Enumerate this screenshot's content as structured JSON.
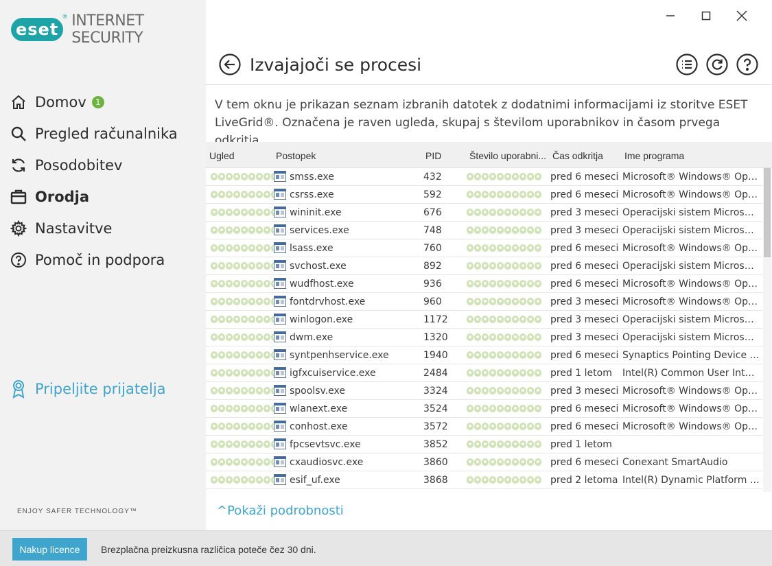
{
  "app": {
    "brand": "eset",
    "product": "INTERNET SECURITY",
    "tagline": "ENJOY SAFER TECHNOLOGY™",
    "brand_color": "#1ea4a6",
    "accent_color": "#3fa5cc"
  },
  "sidebar": {
    "items": [
      {
        "label": "Domov",
        "icon": "home-icon",
        "badge": "1"
      },
      {
        "label": "Pregled računalnika",
        "icon": "search-icon"
      },
      {
        "label": "Posodobitev",
        "icon": "refresh-icon"
      },
      {
        "label": "Orodja",
        "icon": "toolbox-icon",
        "active": true
      },
      {
        "label": "Nastavitve",
        "icon": "gear-icon"
      },
      {
        "label": "Pomoč in podpora",
        "icon": "help-icon"
      }
    ],
    "refer_label": "Pripeljite prijatelja"
  },
  "header": {
    "title": "Izvajajoči se procesi"
  },
  "description": "V tem oknu je prikazan seznam izbranih datotek z dodatnimi informacijami iz storitve ESET LiveGrid®. Označena je raven ugleda, skupaj s številom uporabnikov in časom prvega odkritja.",
  "table": {
    "columns": [
      "Ugled",
      "Postopek",
      "PID",
      "Število uporabni...",
      "Čas odkritja",
      "Ime programa"
    ],
    "rows": [
      {
        "process": "smss.exe",
        "pid": "432",
        "time": "pred 6 meseci",
        "program": "Microsoft® Windows® Operat..."
      },
      {
        "process": "csrss.exe",
        "pid": "592",
        "time": "pred 6 meseci",
        "program": "Microsoft® Windows® Operat..."
      },
      {
        "process": "wininit.exe",
        "pid": "676",
        "time": "pred 3 meseci",
        "program": "Operacijski sistem Microsoft® ..."
      },
      {
        "process": "services.exe",
        "pid": "748",
        "time": "pred 3 meseci",
        "program": "Operacijski sistem Microsoft® ..."
      },
      {
        "process": "lsass.exe",
        "pid": "760",
        "time": "pred 6 meseci",
        "program": "Microsoft® Windows® Operat..."
      },
      {
        "process": "svchost.exe",
        "pid": "892",
        "time": "pred 6 meseci",
        "program": "Operacijski sistem Microsoft® ..."
      },
      {
        "process": "wudfhost.exe",
        "pid": "936",
        "time": "pred 6 meseci",
        "program": "Microsoft® Windows® Operat..."
      },
      {
        "process": "fontdrvhost.exe",
        "pid": "960",
        "time": "pred 3 meseci",
        "program": "Microsoft® Windows® Operat..."
      },
      {
        "process": "winlogon.exe",
        "pid": "1172",
        "time": "pred 3 meseci",
        "program": "Operacijski sistem Microsoft® ..."
      },
      {
        "process": "dwm.exe",
        "pid": "1320",
        "time": "pred 3 meseci",
        "program": "Operacijski sistem Microsoft® ..."
      },
      {
        "process": "syntpenhservice.exe",
        "pid": "1940",
        "time": "pred 6 meseci",
        "program": "Synaptics Pointing Device Driver"
      },
      {
        "process": "igfxcuiservice.exe",
        "pid": "2484",
        "time": "pred 1 letom",
        "program": "Intel(R) Common User Interface"
      },
      {
        "process": "spoolsv.exe",
        "pid": "3324",
        "time": "pred 3 meseci",
        "program": "Microsoft® Windows® Operat..."
      },
      {
        "process": "wlanext.exe",
        "pid": "3524",
        "time": "pred 6 meseci",
        "program": "Microsoft® Windows® Operat..."
      },
      {
        "process": "conhost.exe",
        "pid": "3572",
        "time": "pred 6 meseci",
        "program": "Microsoft® Windows® Operat..."
      },
      {
        "process": "fpcsevtsvc.exe",
        "pid": "3852",
        "time": "pred 1 letom",
        "program": ""
      },
      {
        "process": "cxaudiosvc.exe",
        "pid": "3860",
        "time": "pred 6 meseci",
        "program": "Conexant SmartAudio"
      },
      {
        "process": "esif_uf.exe",
        "pid": "3868",
        "time": "pred 2 letoma",
        "program": "Intel(R) Dynamic Platform and ..."
      }
    ]
  },
  "show_details": "Pokaži podrobnosti",
  "footer": {
    "buy_label": "Nakup licence",
    "trial_text": "Brezplačna preizkusna različica poteče čez 30 dni."
  }
}
